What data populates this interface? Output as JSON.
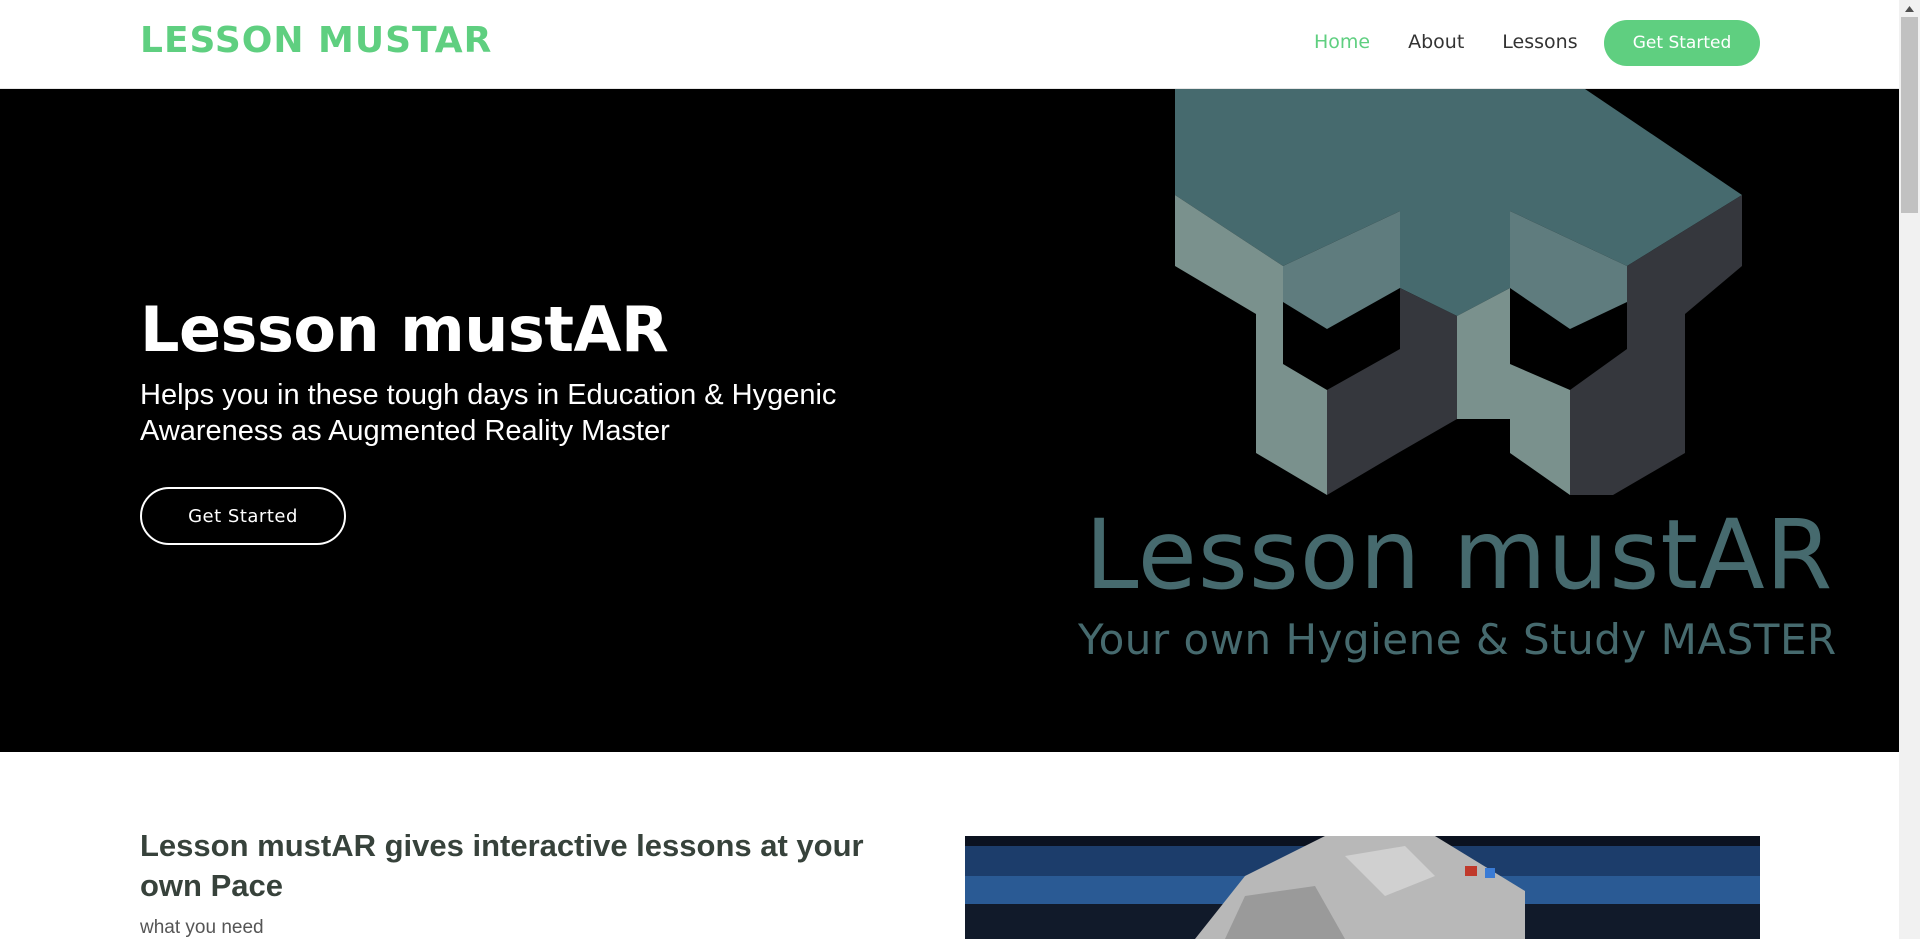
{
  "header": {
    "logo": "LESSON MUSTAR",
    "nav": {
      "home": "Home",
      "about": "About",
      "lessons": "Lessons"
    },
    "cta": "Get Started"
  },
  "hero": {
    "title": "Lesson mustAR",
    "subtitle": "Helps you in these tough days in Education & Hygenic Awareness as Augmented Reality Master",
    "button": "Get Started",
    "art_title": "Lesson mustAR",
    "art_tagline": "Your own Hygiene & Study MASTER"
  },
  "about": {
    "heading": "Lesson mustAR gives interactive lessons at your own Pace",
    "subheading": "what you need"
  },
  "colors": {
    "accent": "#5fcf80",
    "hero_bg": "#000000",
    "logo_block_top": "#466a6e",
    "logo_block_left": "#7a918d",
    "logo_block_right": "#35373d"
  }
}
